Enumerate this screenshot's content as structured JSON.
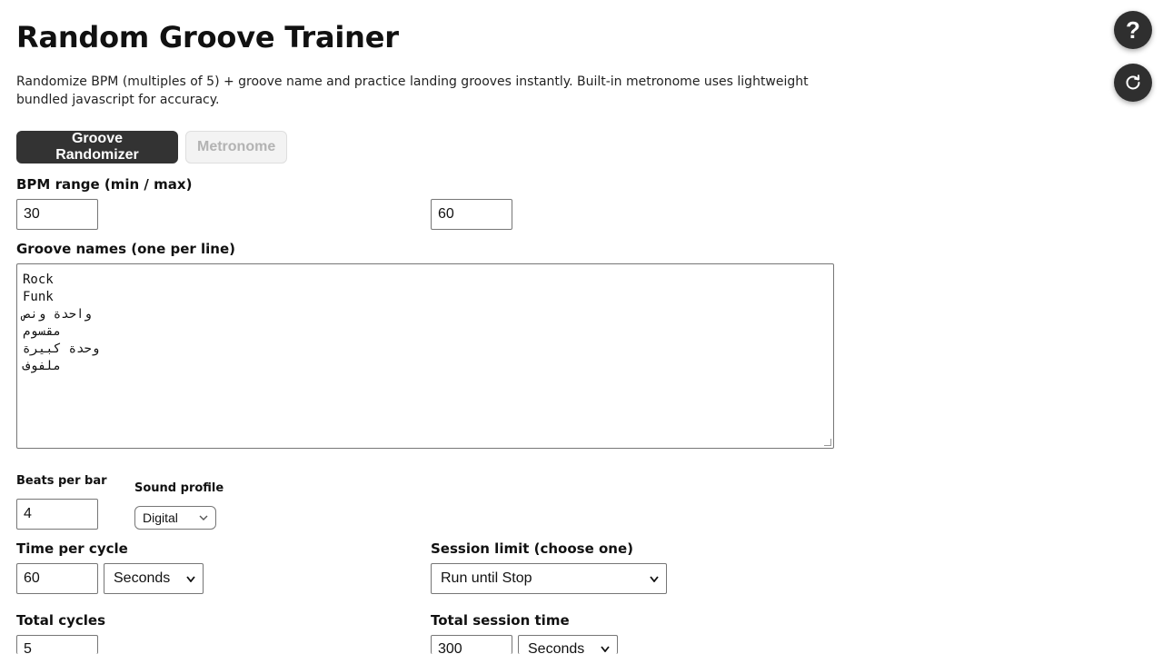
{
  "header": {
    "title": "Random Groove Trainer",
    "description": "Randomize BPM (multiples of 5) + groove name and practice landing grooves instantly. Built-in metronome uses lightweight bundled javascript for accuracy."
  },
  "tabs": [
    {
      "label": "Groove Randomizer",
      "active": true
    },
    {
      "label": "Metronome",
      "active": false
    }
  ],
  "bpm": {
    "label": "BPM range (min / max)",
    "min": "30",
    "max": "60"
  },
  "grooves": {
    "label": "Groove names (one per line)",
    "lines": [
      "Rock",
      "Funk",
      "واحدة ونص",
      "مقسوم",
      "وحدة كبيرة",
      "ملفوف"
    ]
  },
  "beats": {
    "label": "Beats per bar",
    "value": "4"
  },
  "sound": {
    "label": "Sound profile",
    "value": "Digital"
  },
  "cycle": {
    "label": "Time per cycle",
    "value": "60",
    "unit": "Seconds"
  },
  "session_limit": {
    "label": "Session limit (choose one)",
    "value": "Run until Stop"
  },
  "total_cycles": {
    "label": "Total cycles",
    "value": "5"
  },
  "total_session": {
    "label": "Total session time",
    "value": "300",
    "unit": "Seconds"
  },
  "icons": {
    "help": "?",
    "help_icon": "question-icon",
    "reset_icon": "refresh-icon"
  },
  "colors": {
    "accent": "#333333",
    "fab": "#2f2f2f",
    "inactive_text": "#b3b3b3"
  }
}
